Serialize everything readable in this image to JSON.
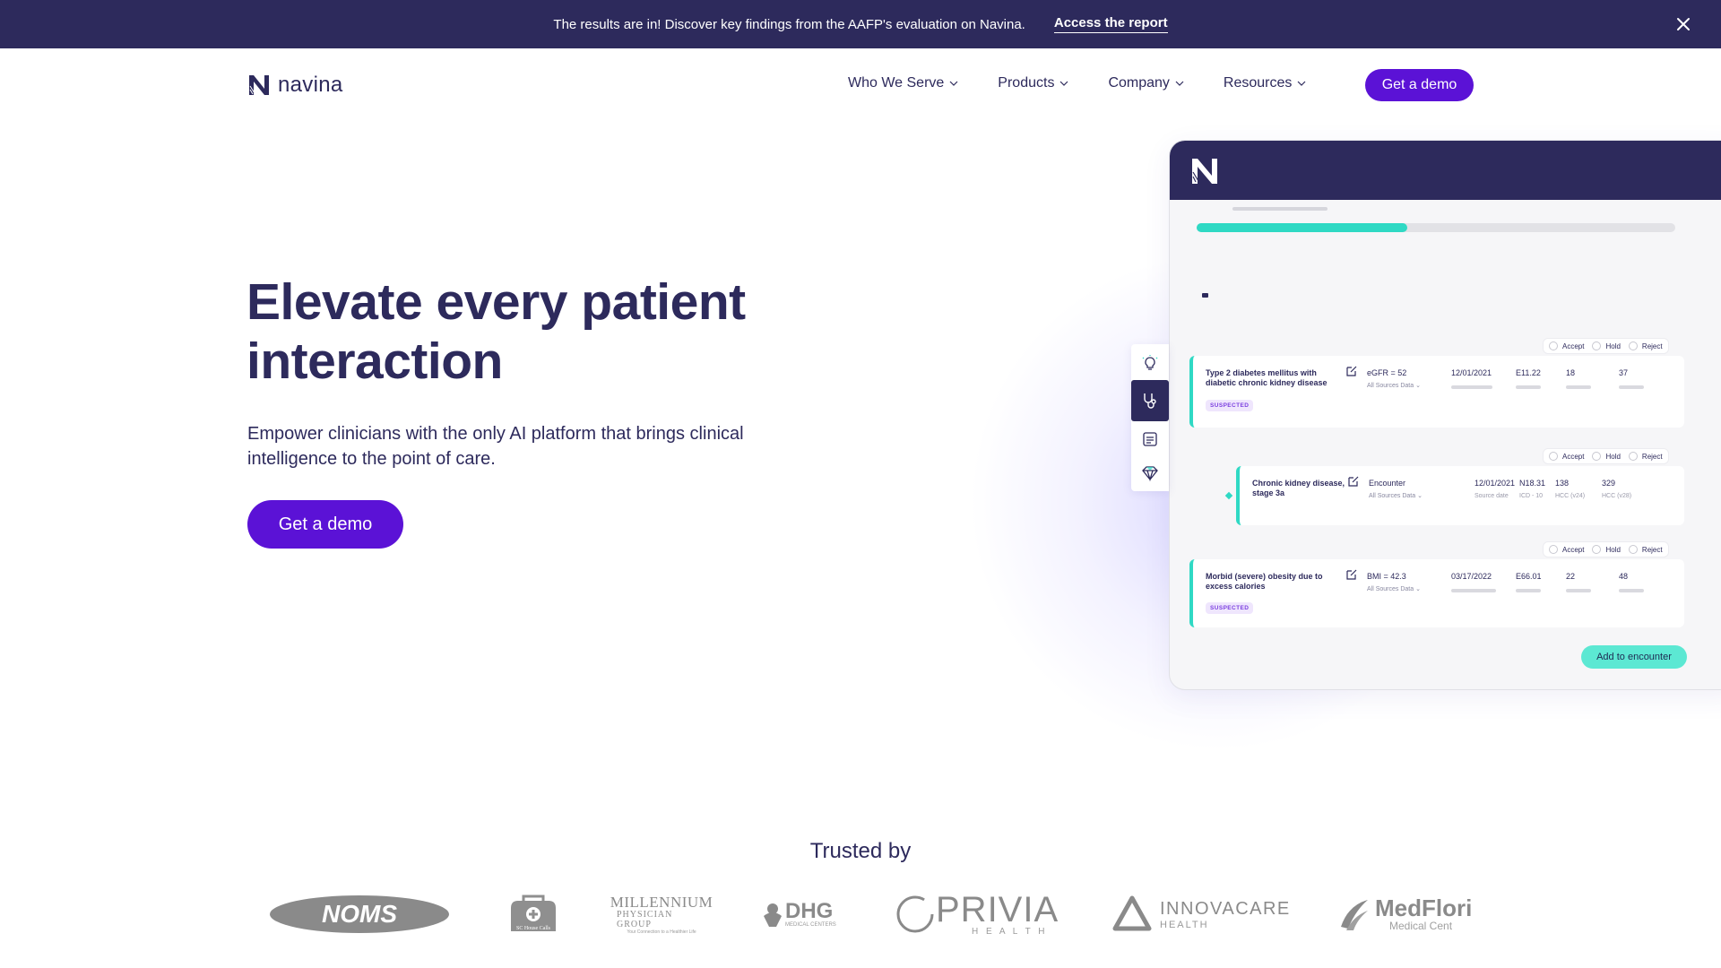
{
  "announcement": {
    "message": "The results are in! Discover key findings from the AAFP's evaluation on Navina.",
    "link": "Access the report"
  },
  "nav": {
    "brand": "navina",
    "items": [
      {
        "label": "Who We Serve"
      },
      {
        "label": "Products"
      },
      {
        "label": "Company"
      },
      {
        "label": "Resources"
      }
    ],
    "cta": "Get a demo"
  },
  "hero": {
    "title": "Elevate every patient interaction",
    "subtitle": "Empower clinicians with the only AI platform that brings clinical intelligence to the point of care.",
    "cta": "Get a demo"
  },
  "mockup": {
    "progress": 0.44,
    "actions": {
      "accept": "Accept",
      "hold": "Hold",
      "reject": "Reject"
    },
    "cards": [
      {
        "condition": "Type 2 diabetes mellitus with diabetic chronic kidney disease",
        "badge": "SUSPECTED",
        "evidence": "eGFR = 52",
        "sources": "All Sources Data",
        "date": "12/01/2021",
        "code": "E11.22",
        "v24": "18",
        "v28": "37"
      },
      {
        "condition": "Chronic kidney disease, stage 3a",
        "evidence": "Encounter",
        "sources": "All Sources Data",
        "date": "12/01/2021",
        "code": "N18.31",
        "v24": "138",
        "v28": "329",
        "sub_date": "Source date",
        "sub_code": "ICD - 10",
        "sub_v24": "HCC (v24)",
        "sub_v28": "HCC (v28)"
      },
      {
        "condition": "Morbid (severe) obesity due to excess calories",
        "badge": "SUSPECTED",
        "evidence": "BMI = 42.3",
        "sources": "All Sources Data",
        "date": "03/17/2022",
        "code": "E66.01",
        "v24": "22",
        "v28": "48"
      }
    ],
    "add_button": "Add to encounter"
  },
  "trusted": {
    "heading": "Trusted by",
    "logos": [
      {
        "name": "NOMS"
      },
      {
        "name": "SC House Calls"
      },
      {
        "name": "MILLENNIUM",
        "sub": "PHYSICIAN GROUP",
        "tag": "Your Connection to a Healthier Life"
      },
      {
        "name": "DHG",
        "sub": "MEDICAL CENTERS"
      },
      {
        "name": "PRIVIA",
        "sub": "H E A L T H"
      },
      {
        "name": "INNOVACARE",
        "sub": "HEALTH"
      },
      {
        "name": "MedFlori",
        "sub": "Medical Cent"
      }
    ]
  }
}
